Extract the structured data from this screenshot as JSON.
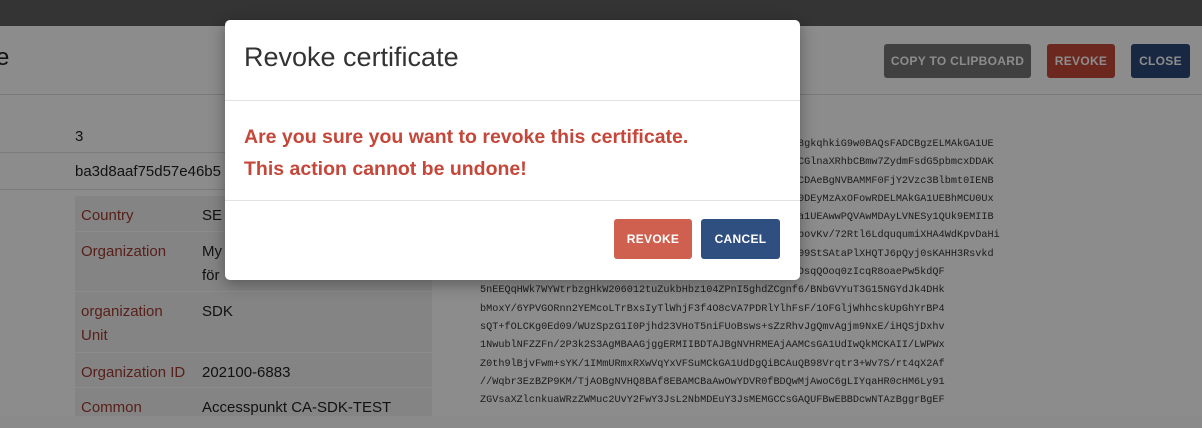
{
  "page": {
    "title": "e",
    "buttons": {
      "copy": "COPY TO CLIPBOARD",
      "revoke": "REVOKE",
      "close": "CLOSE"
    },
    "details": {
      "version": "3",
      "serial": "ba3d8aaf75d57e46b5",
      "subject": [
        {
          "key": "Country",
          "value": "SE"
        },
        {
          "key": "Organization",
          "value": "My",
          "value2": "för"
        },
        {
          "key": "organization Unit",
          "value": "SDK"
        },
        {
          "key": "Organization ID",
          "value": "202100-6883"
        },
        {
          "key": "Common",
          "value": "Accesspunkt CA-SDK-TEST"
        }
      ]
    },
    "certificate_lines": [
      "8gkqhkiG9w0BAQsFADCBgzELMAkGA1UE",
      "CGlnaXRhbCBmw7ZydmFsdG5pbmcxDDAK",
      "CDAeBgNVBAMMF0FjY2Vzc3Blbmt0IENB",
      "0DEyMzAxOFowRDELMAkGA1UEBhMCU0Ux",
      "a1UEAwwPQVAwMDAyLVNESy1QUk9EMIIB",
      "bovKv/72Rtl6LdququmiXHA4WdKpvDaHi",
      "09StSAtaPlXHQTJ6pQyj0sKAHH3Rsvkd",
      "XT/gChuRXchTsaM7XRDW+S/Q4MzA2J1/nO3SugKnvGpndRI+7pffDsqQOoq0zIcqR8oaePw5kdQF",
      "5nEEQqHWk7WYWtrbzgHkW206012tuZukbHbz104ZPnI5ghdZCgnf6/BNbGVYuT3G15NGYdJk4DHk",
      "bMoxY/6YPVGORnn2YEMcoLTrBxsIyTlWhjF3f4O8cVA7PDRlYlhFsF/1OFGljWhhcskUpGhYrBP4",
      "sQT+fOLCKg0Ed09/WUzSpzG1I0Pjhd23VHoT5niFUoBsws+sZzRhvJgQmvAgjm9NxE/iHQSjDxhv",
      "1NwublNFZZFn/2P3k2S3AgMBAAGjggERMIIBDTAJBgNVHRMEAjAAMCsGA1UdIwQkMCKAII/LWPWx",
      "Z0th9lBjvFwm+sYK/1IMmURmxRXwVqYxVFSuMCkGA1UdDgQiBCAuQB98Vrqtr3+Wv7S/rt4qX2Af",
      "//Wqbr3EzBZP9KM/TjAOBgNVHQ8BAf8EBAMCBaAwOwYDVR0fBDQwMjAwoC6gLIYqaHR0cHM6Ly91",
      "ZGVsaXZlcnkuaWRzZWMuc2UvY2FwY3JsL2NbMDEuY3JsMEMGCCsGAQUFBwEBBDcwNTAzBggrBgEF"
    ]
  },
  "dialog": {
    "title": "Revoke certificate",
    "message_line1": "Are you sure you want to revoke this certificate.",
    "message_line2": "This action cannot be undone!",
    "revoke_label": "REVOKE",
    "cancel_label": "CANCEL"
  },
  "colors": {
    "danger": "#c5473a",
    "primary": "#2c4a7a",
    "neutral": "#757575"
  }
}
